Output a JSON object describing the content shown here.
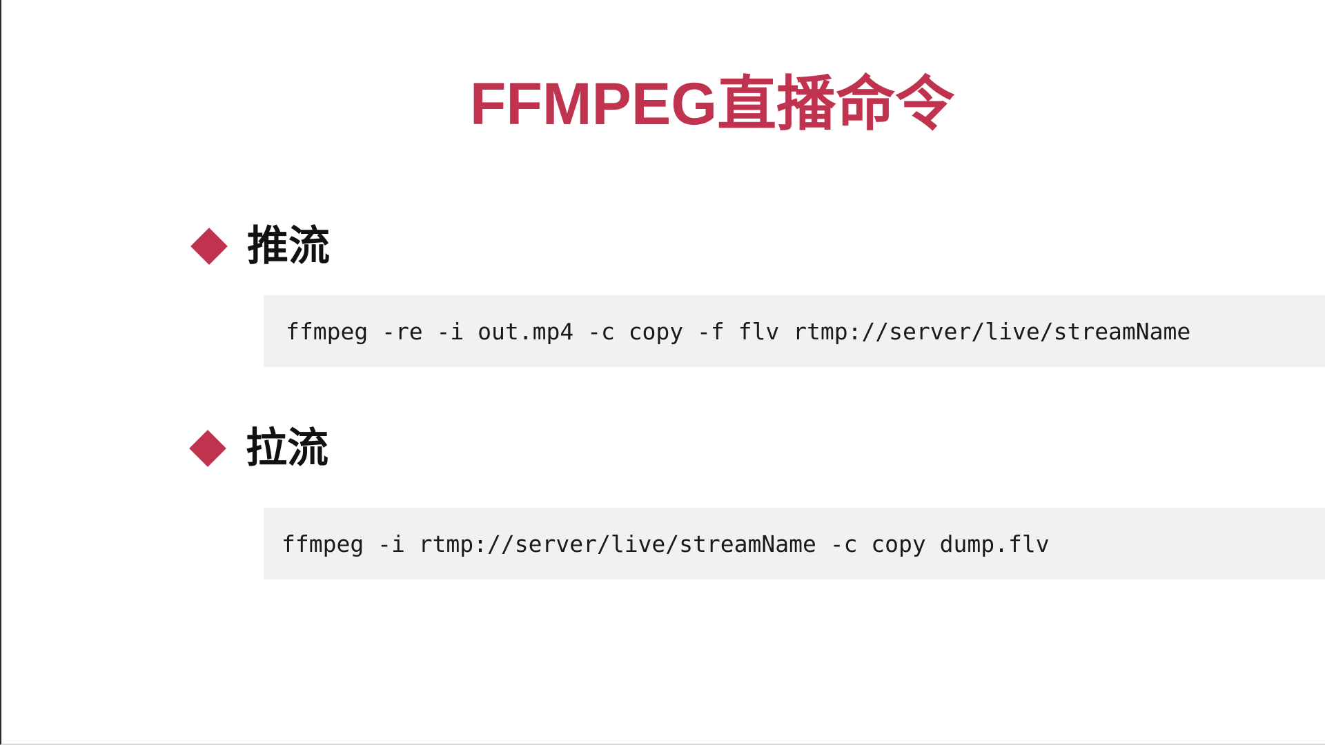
{
  "slide": {
    "title": "FFMPEG直播命令",
    "accent_color": "#c0334f",
    "sections": [
      {
        "heading": "推流",
        "bullet_icon": "diamond-bullet",
        "command": "ffmpeg -re -i out.mp4 -c copy -f flv rtmp://server/live/streamName"
      },
      {
        "heading": "拉流",
        "bullet_icon": "diamond-bullet",
        "command": "ffmpeg -i rtmp://server/live/streamName -c copy dump.flv"
      }
    ]
  }
}
